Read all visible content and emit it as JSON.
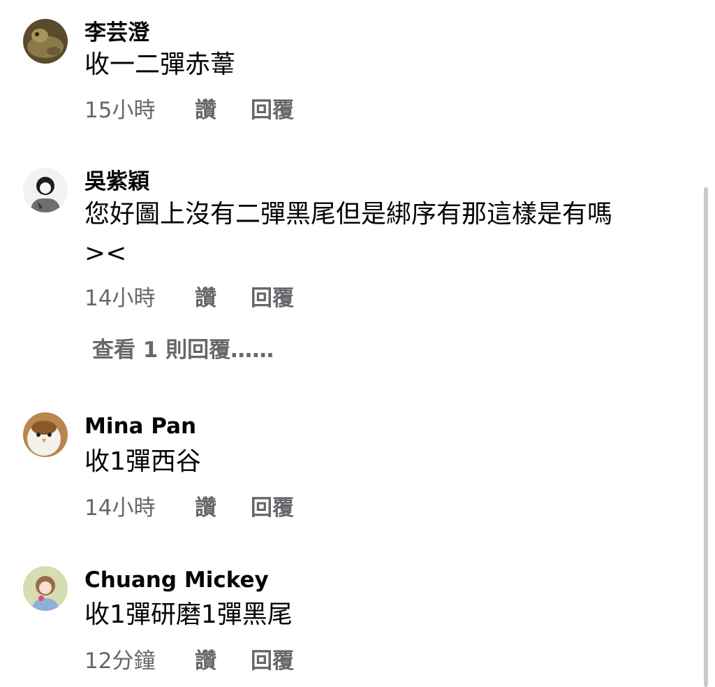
{
  "comments": [
    {
      "author": "李芸澄",
      "text": "收一二彈赤葦",
      "time": "15小時",
      "like": "讚",
      "reply": "回覆"
    },
    {
      "author": "吳紫穎",
      "text": "您好圖上沒有二彈黑尾但是綁序有那這樣是有嗎\n><",
      "time": "14小時",
      "like": "讚",
      "reply": "回覆",
      "view_replies": "查看 1 則回覆……"
    },
    {
      "author": "Mina Pan",
      "text": "收1彈西谷",
      "time": "14小時",
      "like": "讚",
      "reply": "回覆"
    },
    {
      "author": "Chuang Mickey",
      "text": "收1彈研磨1彈黑尾",
      "time": "12分鐘",
      "like": "讚",
      "reply": "回覆"
    }
  ],
  "colors": {
    "text": "#050505",
    "secondary": "#65676b",
    "scrollbar": "#c9c9cc"
  }
}
